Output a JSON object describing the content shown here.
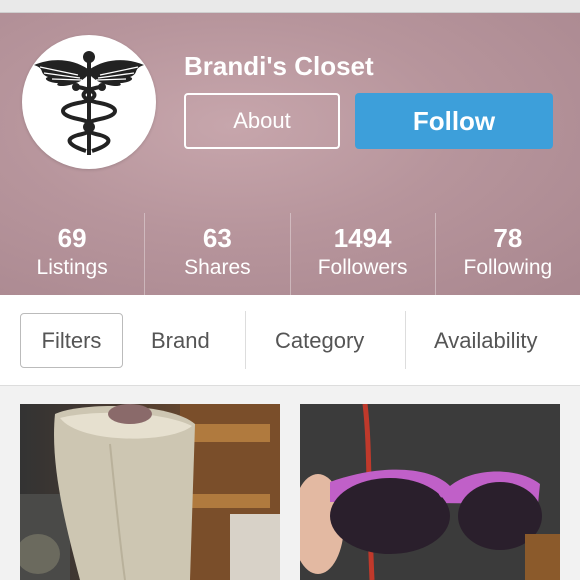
{
  "header": {
    "closet_name": "Brandi's Closet",
    "about_label": "About",
    "follow_label": "Follow"
  },
  "stats": [
    {
      "value": "69",
      "label": "Listings"
    },
    {
      "value": "63",
      "label": "Shares"
    },
    {
      "value": "1494",
      "label": "Followers"
    },
    {
      "value": "78",
      "label": "Following"
    }
  ],
  "filterbar": {
    "filters_label": "Filters",
    "brand_label": "Brand",
    "category_label": "Category",
    "availability_label": "Availability"
  },
  "colors": {
    "header_bg": "#b7959c",
    "follow_button": "#3d9fda"
  },
  "icons": {
    "avatar": "caduceus-icon"
  }
}
